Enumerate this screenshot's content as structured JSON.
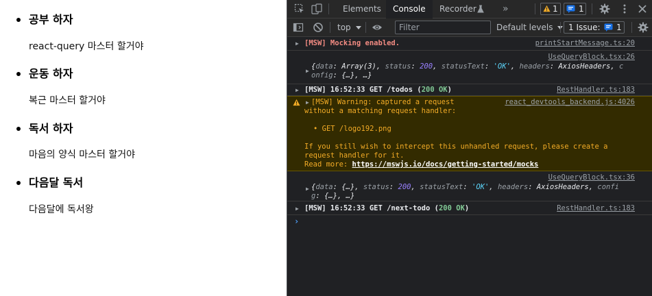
{
  "todos": [
    {
      "title": "공부 하자",
      "desc": "react-query 마스터 할거야"
    },
    {
      "title": "운동 하자",
      "desc": "복근 마스터 할거야"
    },
    {
      "title": "독서 하자",
      "desc": "마음의 양식 마스터 할거야"
    },
    {
      "title": "다음달 독서",
      "desc": "다음달에 독서왕"
    }
  ],
  "devtools": {
    "tabs": [
      "Elements",
      "Console",
      "Recorder"
    ],
    "more_tabs": "»",
    "warning_count": "1",
    "issue_badge_count": "1",
    "accent": "#1a73e8",
    "toolbar": {
      "context": "top",
      "filter_placeholder": "Filter",
      "levels": "Default levels",
      "issues_label": "1 Issue:",
      "issues_count": "1"
    }
  },
  "console": {
    "m1": {
      "text": "[MSW] Mocking enabled.",
      "src": "printStartMessage.ts:20"
    },
    "m2": {
      "src": "UseQueryBlock.tsx:26",
      "k_data": "data",
      "v_data": "Array(3)",
      "k_status": "status",
      "v_status": "200",
      "k_statusText": "statusText",
      "v_statusText": "'OK'",
      "k_headers": "headers",
      "v_headers": "AxiosHeaders",
      "k_config_a": "c",
      "k_config_b": "onfig",
      "v_config": "{…}",
      "ellipsis": "…"
    },
    "m3": {
      "prefix": "[MSW] 16:52:33 GET /todos",
      "status": "200 OK",
      "src": "RestHandler.ts:183"
    },
    "m4": {
      "line1": "[MSW] Warning: captured a request",
      "line2": "without a matching request handler:",
      "bullet": "• GET /logo192.png",
      "line4": "If you still wish to intercept this unhandled request, please create a",
      "line5": "request handler for it.",
      "read_more": "Read more:",
      "url": "https://mswjs.io/docs/getting-started/mocks",
      "src": "react_devtools_backend.js:4026"
    },
    "m5": {
      "src": "UseQueryBlock.tsx:36",
      "k_data": "data",
      "v_data": "{…}",
      "k_status": "status",
      "v_status": "200",
      "k_statusText": "statusText",
      "v_statusText": "'OK'",
      "k_headers": "headers",
      "v_headers": "AxiosHeaders",
      "k_config_a": "confi",
      "k_config_b": "g",
      "v_config": "{…}",
      "ellipsis": "…"
    },
    "m6": {
      "prefix": "[MSW] 16:52:33 GET /next-todo",
      "status": "200 OK",
      "src": "RestHandler.ts:183"
    },
    "prompt": "›"
  }
}
